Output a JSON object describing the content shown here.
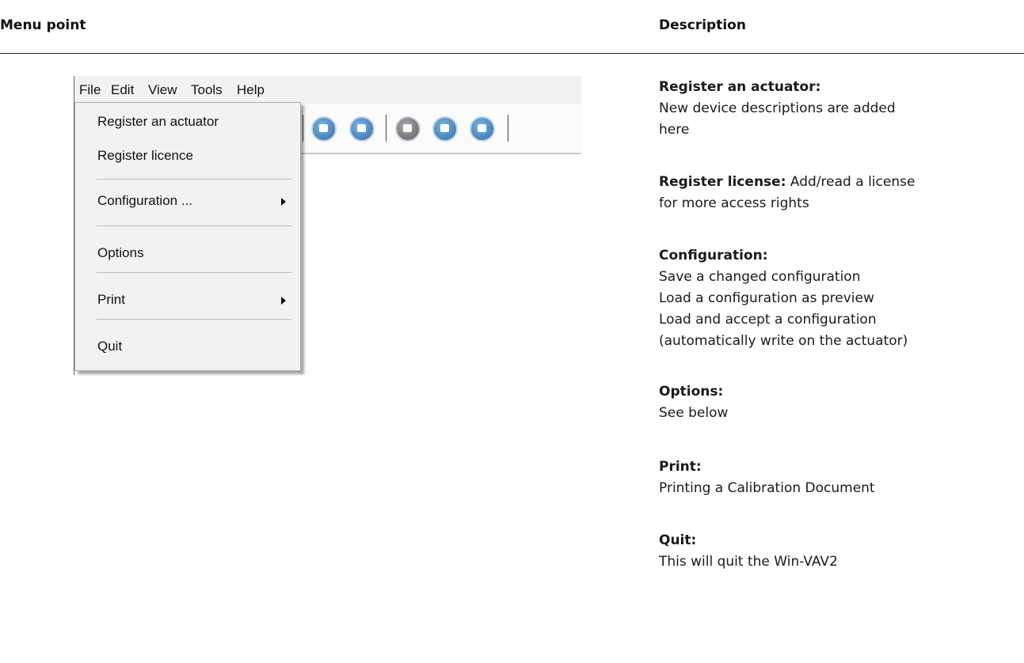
{
  "header": {
    "left": "Menu point",
    "right": "Description"
  },
  "app": {
    "menubar": [
      "File",
      "Edit",
      "View",
      "Tools",
      "Help"
    ],
    "file_menu": {
      "items": [
        "Register an actuator",
        "Register licence",
        "Configuration ...",
        "Options",
        "Print",
        "Quit"
      ]
    },
    "toolbar_icons": [
      "print-icon",
      "document-icon",
      "edit-icon",
      "folder-icon",
      "refresh-icon"
    ]
  },
  "descriptions": [
    {
      "title": "Register an actuator:",
      "lines": [
        "New device descriptions are added",
        "here"
      ]
    },
    {
      "title": "Register license:",
      "inline": " Add/read a license",
      "lines": [
        "for more access rights"
      ]
    },
    {
      "title": "Configuration:",
      "lines": [
        "Save a changed configuration",
        "Load a configuration as preview",
        "Load and accept a configuration",
        "(automatically write on the actuator)"
      ]
    },
    {
      "title": "Options:",
      "lines": [
        "See below"
      ]
    },
    {
      "title": "Print:",
      "lines": [
        "Printing a Calibration Document"
      ]
    },
    {
      "title": "Quit:",
      "lines": [
        "This will quit the Win-VAV2"
      ]
    }
  ]
}
